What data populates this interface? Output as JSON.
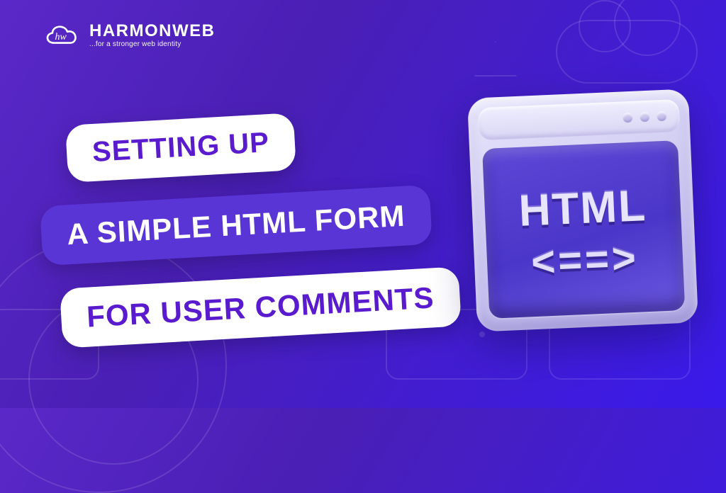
{
  "logo": {
    "brand": "HARMONWEB",
    "tagline": "...for a stronger web identity"
  },
  "title": {
    "line1": "SETTING UP",
    "line2": "A SIMPLE HTML FORM",
    "line3": "FOR USER COMMENTS"
  },
  "illustration": {
    "panel_label": "HTML",
    "panel_code": "<==>"
  }
}
